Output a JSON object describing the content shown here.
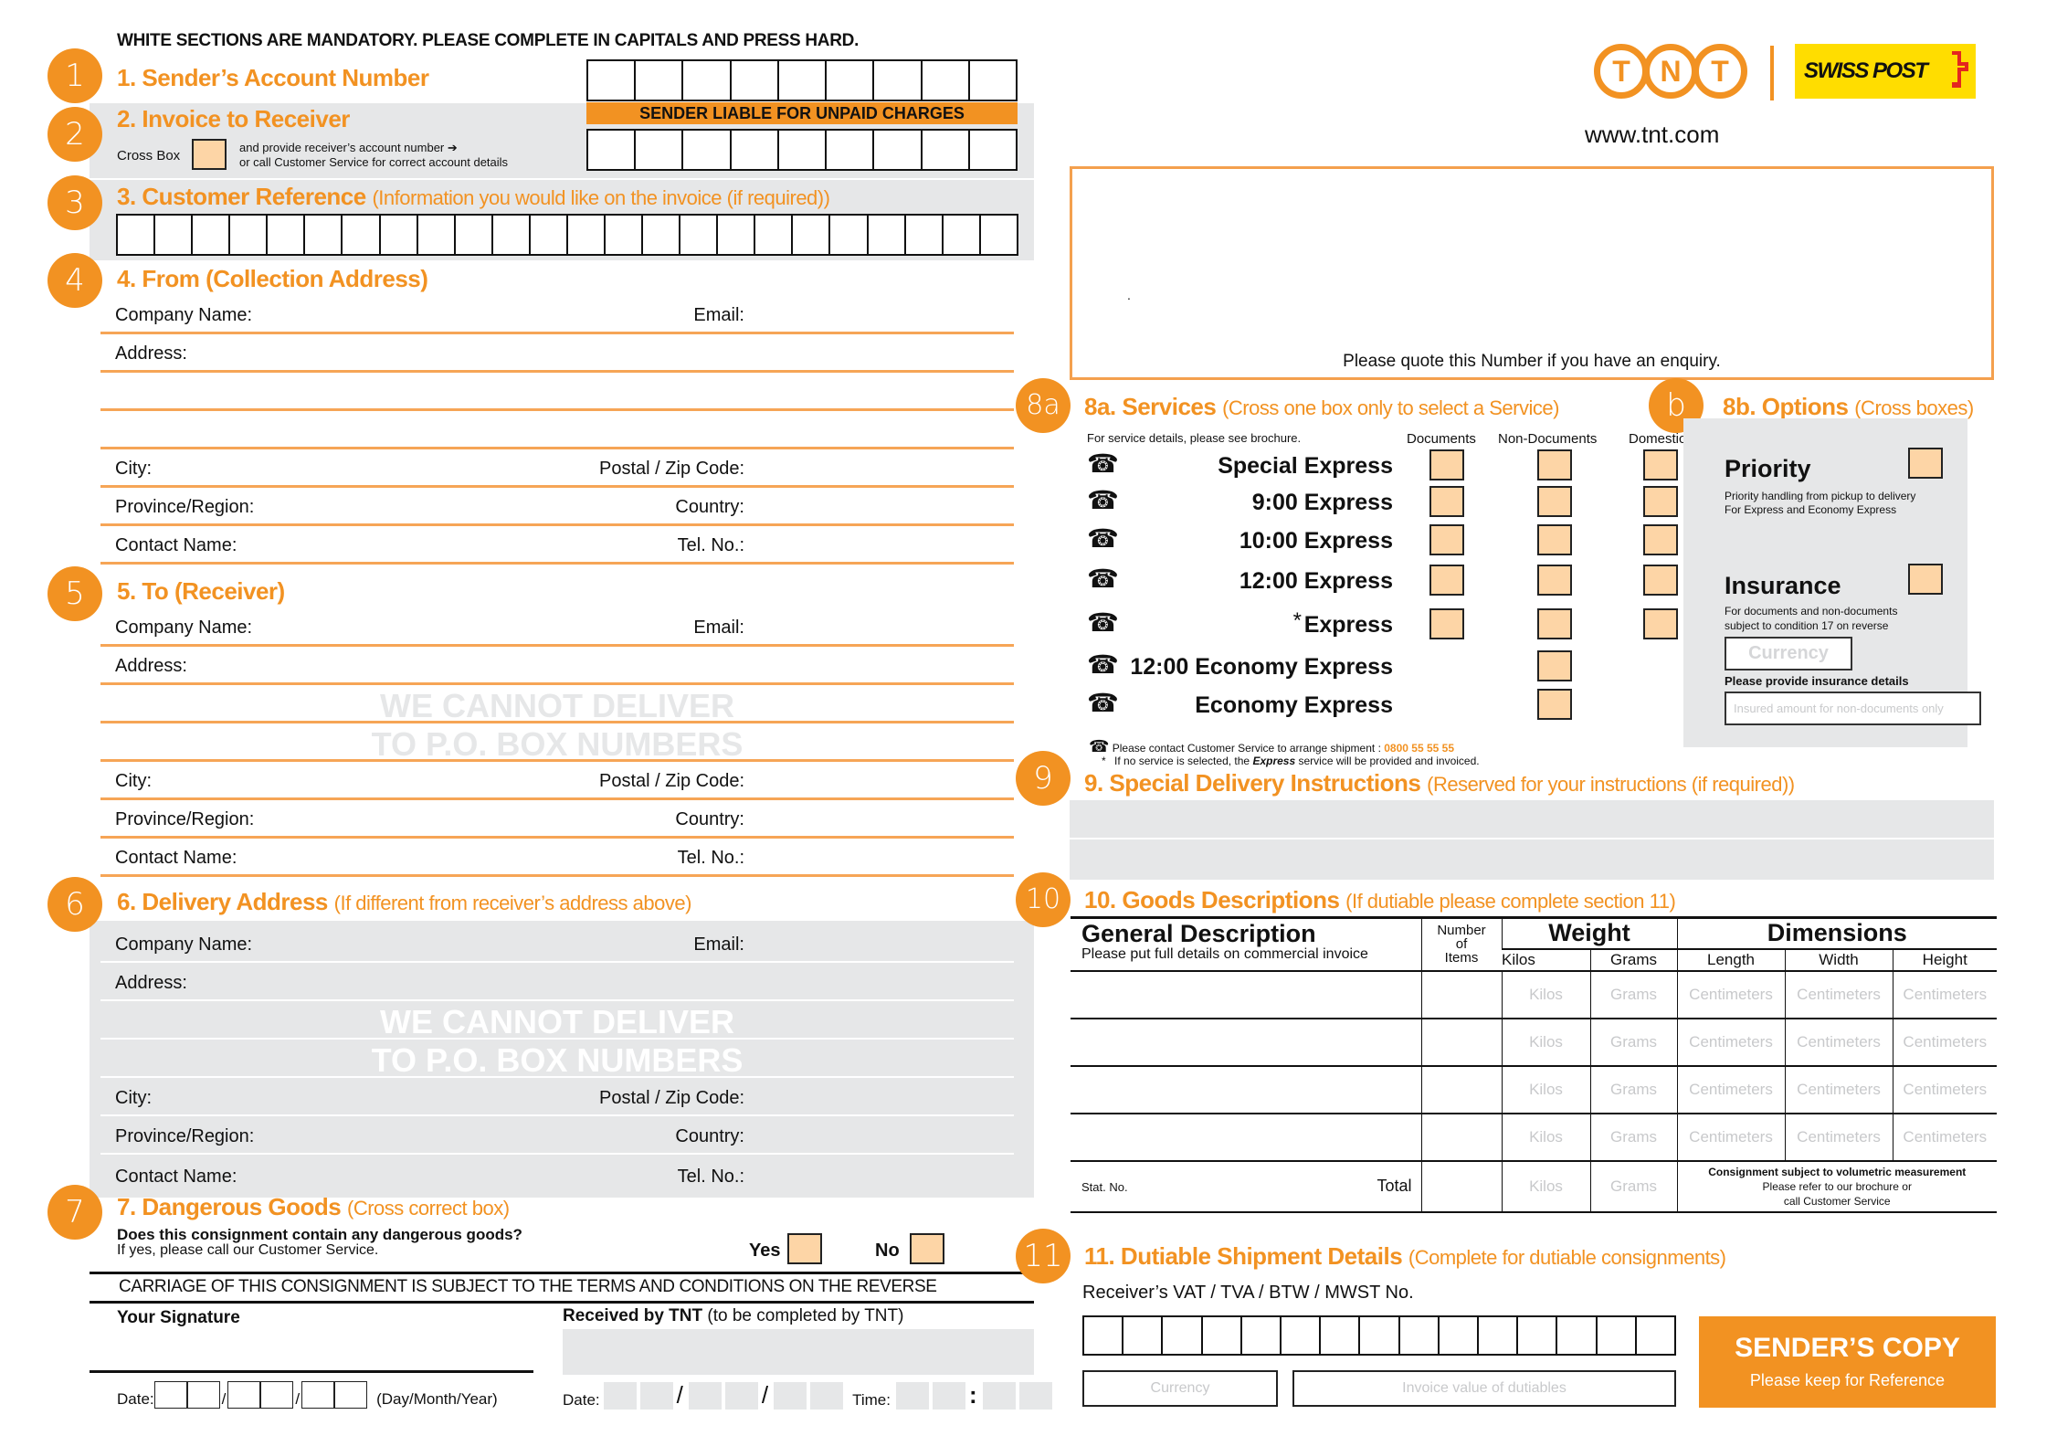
{
  "header": {
    "instruction": "WHITE SECTIONS ARE MANDATORY. PLEASE COMPLETE IN CAPITALS AND PRESS HARD.",
    "logo_tnt": [
      "T",
      "N",
      "T"
    ],
    "logo_partner": "SWISS POST",
    "website": "www.tnt.com",
    "consignment_note": "Please quote this Number if you have an enquiry.",
    "consignment_number": "."
  },
  "section1": {
    "badge": "1",
    "title": "1. Sender’s Account Number",
    "cells": 9
  },
  "section2": {
    "badge": "2",
    "title": "2. Invoice to Receiver",
    "banner": "SENDER LIABLE FOR UNPAID CHARGES",
    "cross_box_label": "Cross Box",
    "instruction_line1": "and provide receiver’s account number ➔",
    "instruction_line2": "or call Customer Service for correct account details",
    "cells": 9
  },
  "section3": {
    "badge": "3",
    "title": "3. Customer Reference",
    "subtitle": "(Information you would like on the invoice (if required))",
    "cells": 24
  },
  "section4": {
    "badge": "4",
    "title": "4. From (Collection Address)",
    "fields": {
      "company": "Company Name:",
      "email": "Email:",
      "address": "Address:",
      "city": "City:",
      "postal": "Postal / Zip Code:",
      "province": "Province/Region:",
      "country": "Country:",
      "contact": "Contact Name:",
      "tel": "Tel. No.:"
    }
  },
  "section5": {
    "badge": "5",
    "title": "5. To (Receiver)",
    "watermark_line1": "WE CANNOT DELIVER",
    "watermark_line2": "TO P.O. BOX NUMBERS",
    "fields": {
      "company": "Company Name:",
      "email": "Email:",
      "address": "Address:",
      "city": "City:",
      "postal": "Postal / Zip Code:",
      "province": "Province/Region:",
      "country": "Country:",
      "contact": "Contact Name:",
      "tel": "Tel. No.:"
    }
  },
  "section6": {
    "badge": "6",
    "title": "6. Delivery Address",
    "subtitle": "(If different from receiver’s address above)",
    "watermark_line1": "WE CANNOT DELIVER",
    "watermark_line2": "TO P.O. BOX NUMBERS",
    "fields": {
      "company": "Company Name:",
      "email": "Email:",
      "address": "Address:",
      "city": "City:",
      "postal": "Postal / Zip Code:",
      "province": "Province/Region:",
      "country": "Country:",
      "contact": "Contact Name:",
      "tel": "Tel. No.:"
    }
  },
  "section7": {
    "badge": "7",
    "title": "7. Dangerous Goods",
    "subtitle": "(Cross correct box)",
    "question": "Does this consignment contain any dangerous goods?",
    "note": "If yes, please call our Customer Service.",
    "yes": "Yes",
    "no": "No",
    "terms": "CARRIAGE OF THIS CONSIGNMENT IS SUBJECT TO THE TERMS AND CONDITIONS ON THE REVERSE",
    "signature_label": "Your Signature",
    "received_label": "Received by TNT",
    "received_note": "(to be completed by TNT)",
    "date_label": "Date:",
    "date_format": "(Day/Month/Year)",
    "tnt_date_label": "Date:",
    "time_label": "Time:",
    "separator": "/",
    "time_separator": ":"
  },
  "section8a": {
    "badge": "8a",
    "title": "8a. Services",
    "subtitle": "(Cross one box only to select a Service)",
    "note": "For service details, please see brochure.",
    "columns": [
      "Documents",
      "Non-Documents",
      "Domestic"
    ],
    "services": [
      {
        "name": "Special Express",
        "boxes": [
          true,
          true,
          true
        ]
      },
      {
        "name": "9:00 Express",
        "boxes": [
          true,
          true,
          true
        ]
      },
      {
        "name": "10:00 Express",
        "boxes": [
          true,
          true,
          true
        ]
      },
      {
        "name": "12:00 Express",
        "boxes": [
          true,
          true,
          true
        ]
      },
      {
        "name": "Express",
        "asterisk": "*",
        "boxes": [
          true,
          true,
          true
        ]
      },
      {
        "name": "12:00 Economy Express",
        "boxes": [
          false,
          true,
          false
        ]
      },
      {
        "name": "Economy Express",
        "boxes": [
          false,
          true,
          false
        ]
      }
    ],
    "footnote_phone": "Please contact Customer Service to arrange shipment :",
    "phone_number": "0800 55 55 55",
    "footnote_asterisk": "*",
    "footnote_express_pre": "If no service is selected, the",
    "footnote_express_word": "Express",
    "footnote_express_post": "service will be provided and invoiced."
  },
  "section8b": {
    "badge": "b",
    "title": "8b. Options",
    "subtitle": "(Cross boxes)",
    "priority_title": "Priority",
    "priority_line1": "Priority handling from pickup to delivery",
    "priority_line2": "For Express and Economy Express",
    "insurance_title": "Insurance",
    "insurance_line1": "For documents and non-documents",
    "insurance_line2": "subject to condition 17 on reverse",
    "currency_placeholder": "Currency",
    "insurance_details_label": "Please provide insurance details",
    "insured_amount_placeholder": "Insured amount for non-documents only"
  },
  "section9": {
    "badge": "9",
    "title": "9. Special Delivery Instructions",
    "subtitle": "(Reserved for your instructions (if required))"
  },
  "section10": {
    "badge": "10",
    "title": "10. Goods Descriptions",
    "subtitle": "(If dutiable please complete section 11)",
    "general_description": "General Description",
    "general_note": "Please put full details on commercial invoice",
    "number_of_items": [
      "Number",
      "of",
      "Items"
    ],
    "weight": "Weight",
    "dimensions": "Dimensions",
    "weight_cols": [
      "Kilos",
      "Grams"
    ],
    "dimension_cols": [
      "Length",
      "Width",
      "Height"
    ],
    "row_placeholders": [
      "Kilos",
      "Grams",
      "Centimeters",
      "Centimeters",
      "Centimeters"
    ],
    "row_count": 4,
    "stat_no": "Stat. No.",
    "total": "Total",
    "total_placeholders": [
      "Kilos",
      "Grams"
    ],
    "volumetric_line1": "Consignment subject to volumetric measurement",
    "volumetric_line2": "Please refer to our brochure or",
    "volumetric_line3": "call Customer Service"
  },
  "section11": {
    "badge": "11",
    "title": "11. Dutiable Shipment Details",
    "subtitle": "(Complete for dutiable consignments)",
    "vat_label": "Receiver’s VAT / TVA / BTW / MWST No.",
    "vat_cells": 15,
    "currency_placeholder": "Currency",
    "invoice_value_placeholder": "Invoice value of dutiables"
  },
  "senders_copy": {
    "title": "SENDER’S COPY",
    "subtitle": "Please keep for Reference"
  },
  "colors": {
    "accent": "#f29222",
    "checkbox_fill": "#fdd5a6",
    "grey_panel": "#e6e7e8",
    "rule": "#f6a556",
    "swiss_post_yellow": "#ffdd00",
    "swiss_post_red": "#e4261f"
  }
}
